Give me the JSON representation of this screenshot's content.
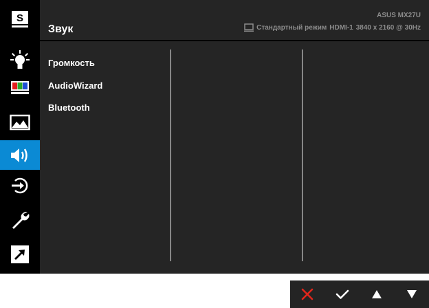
{
  "header": {
    "title": "Звук",
    "model": "ASUS MX27U",
    "mode": "Стандартный режим",
    "input": "HDMI-1",
    "resolution": "3840 x 2160 @ 30Hz"
  },
  "sidebar": {
    "items": [
      {
        "id": "splendid",
        "icon": "splendid-s-icon",
        "letter": "S"
      },
      {
        "id": "blue-light",
        "icon": "bulb-icon"
      },
      {
        "id": "color",
        "icon": "color-bars-icon"
      },
      {
        "id": "image",
        "icon": "image-mountain-icon"
      },
      {
        "id": "sound",
        "icon": "speaker-icon",
        "active": true
      },
      {
        "id": "input",
        "icon": "input-select-icon"
      },
      {
        "id": "system",
        "icon": "wrench-icon"
      },
      {
        "id": "shortcut",
        "icon": "shortcut-arrow-icon"
      }
    ]
  },
  "menu": {
    "items": [
      "Громкость",
      "AudioWizard",
      "Bluetooth"
    ]
  },
  "nav": {
    "buttons": [
      "close-icon",
      "confirm-check-icon",
      "up-arrow-icon",
      "down-arrow-icon"
    ]
  },
  "colors": {
    "accent": "#0b8ad4",
    "panel": "#252525",
    "close": "#e0261b",
    "muted_text": "#8c8c8c"
  }
}
